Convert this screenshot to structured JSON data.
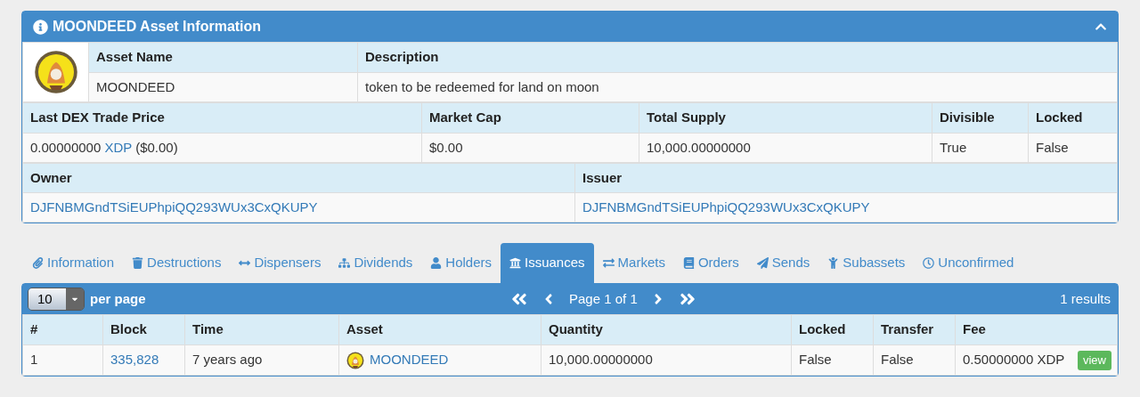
{
  "asset_panel": {
    "title": "MOONDEED Asset Information",
    "expanded": true,
    "name_header": "Asset Name",
    "description_header": "Description",
    "name": "MOONDEED",
    "description": "token to be redeemed for land on moon",
    "price_header": "Last DEX Trade Price",
    "price_amount": "0.00000000",
    "price_unit": "XDP",
    "price_usd": "($0.00)",
    "market_cap_header": "Market Cap",
    "market_cap": "$0.00",
    "supply_header": "Total Supply",
    "supply": "10,000.00000000",
    "divisible_header": "Divisible",
    "divisible": "True",
    "locked_header": "Locked",
    "locked": "False",
    "owner_header": "Owner",
    "owner": "DJFNBMGndTSiEUPhpiQQ293WUx3CxQKUPY",
    "issuer_header": "Issuer",
    "issuer": "DJFNBMGndTSiEUPhpiQQ293WUx3CxQKUPY"
  },
  "tabs": [
    {
      "label": "Information",
      "selected": false
    },
    {
      "label": "Destructions",
      "selected": false
    },
    {
      "label": "Dispensers",
      "selected": false
    },
    {
      "label": "Dividends",
      "selected": false
    },
    {
      "label": "Holders",
      "selected": false
    },
    {
      "label": "Issuances",
      "selected": true
    },
    {
      "label": "Markets",
      "selected": false
    },
    {
      "label": "Orders",
      "selected": false
    },
    {
      "label": "Sends",
      "selected": false
    },
    {
      "label": "Subassets",
      "selected": false
    },
    {
      "label": "Unconfirmed",
      "selected": false
    }
  ],
  "table": {
    "per_page_value": "10",
    "per_page_label": "per page",
    "page_label": "Page 1 of 1",
    "results": "1 results",
    "columns": [
      "#",
      "Block",
      "Time",
      "Asset",
      "Quantity",
      "Locked",
      "Transfer",
      "Fee"
    ],
    "rows": [
      {
        "index": "1",
        "block": "335,828",
        "time": "7 years ago",
        "asset": "MOONDEED",
        "quantity": "10,000.00000000",
        "locked": "False",
        "transfer": "False",
        "fee": "0.50000000 XDP",
        "action": "view"
      }
    ]
  }
}
